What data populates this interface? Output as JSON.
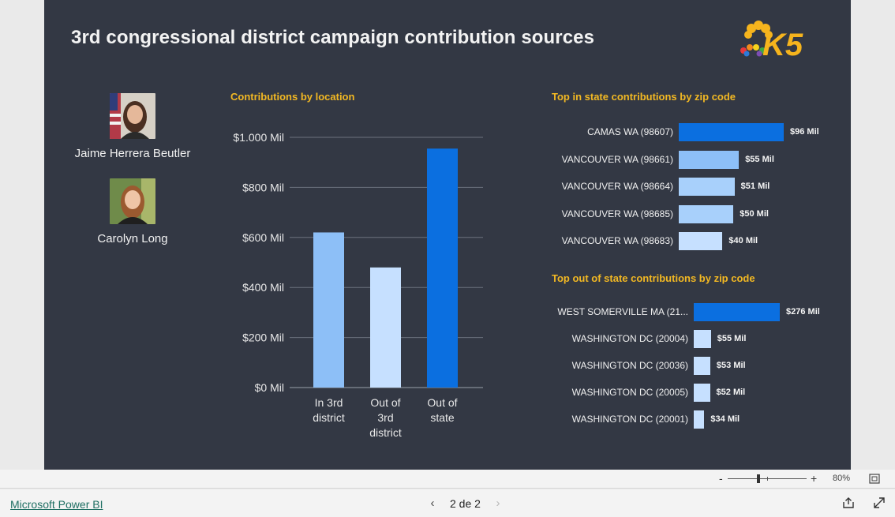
{
  "report": {
    "title": "3rd congressional district campaign contribution sources",
    "logo_text": "K5",
    "candidates": [
      {
        "name": "Jaime Herrera Beutler"
      },
      {
        "name": "Carolyn Long"
      }
    ]
  },
  "chart_data": [
    {
      "type": "bar",
      "title": "Contributions by location",
      "categories": [
        "In 3rd district",
        "Out of 3rd district",
        "Out of state"
      ],
      "category_lines": [
        [
          "In 3rd",
          "district"
        ],
        [
          "Out of",
          "3rd",
          "district"
        ],
        [
          "Out of",
          "state"
        ]
      ],
      "values": [
        620,
        480,
        955
      ],
      "ylim": [
        0,
        1000
      ],
      "yticks": [
        0,
        200,
        400,
        600,
        800,
        1000
      ],
      "ytick_labels": [
        "$0 Mil",
        "$200 Mil",
        "$400 Mil",
        "$600 Mil",
        "$800 Mil",
        "$1.000 Mil"
      ],
      "colors": [
        "#8dbff7",
        "#c6e0ff",
        "#0b6fe0"
      ],
      "grid": true
    },
    {
      "type": "bar",
      "orientation": "horizontal",
      "title": "Top in state contributions by zip code",
      "categories": [
        "CAMAS WA (98607)",
        "VANCOUVER WA (98661)",
        "VANCOUVER WA (98664)",
        "VANCOUVER WA (98685)",
        "VANCOUVER WA (98683)"
      ],
      "values": [
        96,
        55,
        51,
        50,
        40
      ],
      "value_labels": [
        "$96 Mil",
        "$55 Mil",
        "$51 Mil",
        "$50 Mil",
        "$40 Mil"
      ],
      "colors": [
        "#0b6fe0",
        "#8dbff7",
        "#a8d0fb",
        "#a8d0fb",
        "#c6e0ff"
      ]
    },
    {
      "type": "bar",
      "orientation": "horizontal",
      "title": "Top out of state contributions by zip code",
      "categories": [
        "WEST SOMERVILLE MA (21...",
        "WASHINGTON DC (20004)",
        "WASHINGTON DC (20036)",
        "WASHINGTON DC (20005)",
        "WASHINGTON DC (20001)"
      ],
      "values": [
        276,
        55,
        53,
        52,
        34
      ],
      "value_labels": [
        "$276 Mil",
        "$55 Mil",
        "$53 Mil",
        "$52 Mil",
        "$34 Mil"
      ],
      "colors": [
        "#0b6fe0",
        "#c6e0ff",
        "#c6e0ff",
        "#c6e0ff",
        "#c6e0ff"
      ]
    }
  ],
  "zoom": {
    "minus": "-",
    "plus": "+",
    "level": "80%",
    "value": 0.8
  },
  "footer": {
    "link": "Microsoft Power BI",
    "prev": "‹",
    "page": "2 de 2",
    "next": "›"
  }
}
